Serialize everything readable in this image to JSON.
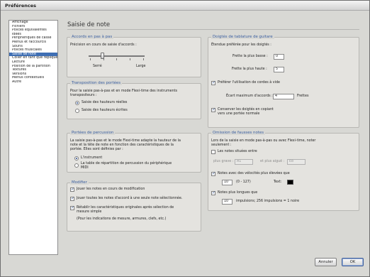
{
  "window": {
    "title": "Préférences"
  },
  "sidebar": {
    "items": [
      "Affichage",
      "Fichiers",
      "Polices équivalentes",
      "Idées",
      "Périphériques de casse",
      "Menus et raccourcis",
      "Souris",
      "Polices musicales",
      "Saisie de note",
      "Coller en tant que réplique",
      "Lecture",
      "Position de la partition",
      "Textures",
      "Versions",
      "Menus contextuels",
      "Autre"
    ],
    "selected_index": 8
  },
  "pane": {
    "title": "Saisie de note"
  },
  "step_entry": {
    "title": "Accords en pas à pas",
    "precision_label": "Précision en cours de saisie d'accords :",
    "slider_min_label": "Serré",
    "slider_max_label": "Large",
    "slider_value": 0.25
  },
  "transpose": {
    "title": "Transposition des portées",
    "description_1": "Pour la saisie pas-à-pas et en mode Flexi-time des instruments",
    "description_2": "transpositeurs :",
    "option_real": "Saisie des hauteurs réelles",
    "option_written": "Saisie des hauteurs écrites",
    "selected": "real"
  },
  "percussion": {
    "title": "Portées de percussion",
    "description_1": "La saisie pas-à-pas et le mode Flexi-time adapte la hauteur de la",
    "description_2": "note et la tête de note en fonction des caractéristiques de la",
    "description_3": "portée. Elles sont définies par :",
    "option_instrument": "L'instrument",
    "option_table_1": "La table de répartition de percussion du périphérique",
    "option_table_2": "MIDI",
    "selected": "instrument"
  },
  "edit": {
    "title": "Modifier",
    "play_notes": "Jouer les notes en cours de modification",
    "play_all_chord_notes": "Jouer toutes les notes d'accord à une seule note sélectionnée.",
    "reset_1": "Rétablir les caractéristiques originales après sélection de",
    "reset_2": "mesure simple",
    "reset_note": "(Pour les indications de mesure, armures, clefs, etc.)",
    "play_notes_checked": true,
    "play_all_checked": true,
    "reset_checked": true
  },
  "tab_fingering": {
    "title": "Doigtés de tablature de guitare",
    "range_label": "Étendue préférée pour les doigtés :",
    "lowest_fret_label": "Frette la plus basse :",
    "lowest_fret_value": "0",
    "highest_fret_label": "Frette la plus haute :",
    "highest_fret_value": "5",
    "prefer_open_strings": "Préférer l'utilisation de cordes à vide",
    "prefer_open_checked": true,
    "max_chord_spacing_label": "Écart maximum d'accords :",
    "max_chord_spacing_value": "4",
    "max_chord_spacing_unit": "Frettes",
    "keep_fingering_1": "Conserver les doigtés en copiant",
    "keep_fingering_2": "vers une portée normale",
    "keep_fingering_checked": true
  },
  "wrong_notes": {
    "title": "Omission de fausses notes",
    "description_1": "Lors de la saisie en mode pas-à-pas ou avec Flexi-time, noter",
    "description_2": "seulement :",
    "notes_between": "Les notes situées entre",
    "notes_between_checked": false,
    "lowest_label": "plus grave :",
    "lowest_value": "A1",
    "highest_label": "et plus aiguë :",
    "highest_value": "E8",
    "velocity_label": "Notes avec des vélocités plus élevées que",
    "velocity_checked": true,
    "velocity_value": "10",
    "velocity_range": "(0 - 127)",
    "text_label": "Text:",
    "text_color": "#000000",
    "longer_label": "Notes plus longues que",
    "longer_checked": true,
    "longer_value": "10",
    "longer_unit": "impulsions; 256 impulsions = 1 noire"
  },
  "buttons": {
    "cancel": "Annuler",
    "ok": "OK"
  }
}
